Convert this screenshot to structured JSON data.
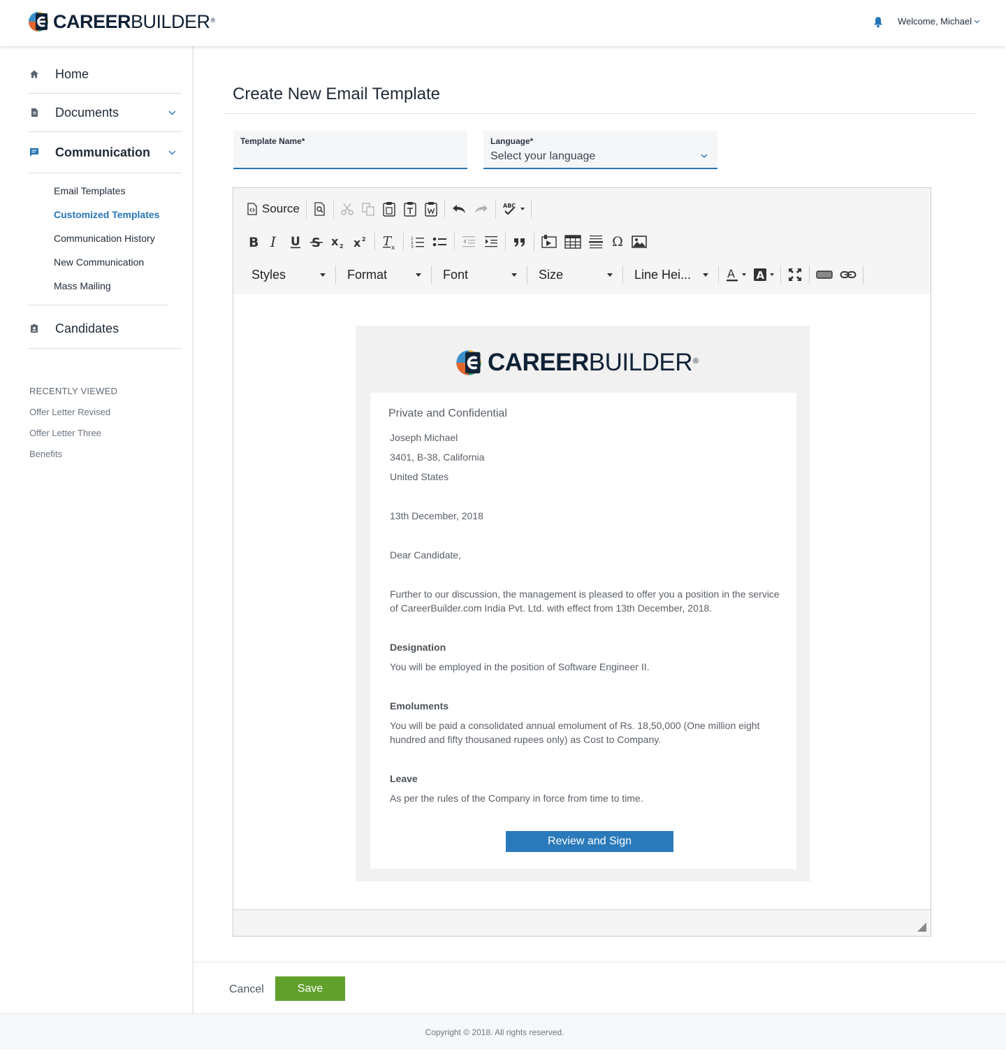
{
  "header": {
    "brand_bold": "CAREER",
    "brand_light": "BUILDER",
    "brand_mark": "®",
    "welcome": "Welcome, Michael",
    "icons": [
      "bell-icon",
      "chevron-down-icon"
    ]
  },
  "sidebar": {
    "items": [
      {
        "label": "Home",
        "icon": "home-icon"
      },
      {
        "label": "Documents",
        "icon": "document-icon"
      },
      {
        "label": "Communication",
        "icon": "chat-icon"
      },
      {
        "label": "Candidates",
        "icon": "contact-card-icon"
      }
    ],
    "sub_items": [
      {
        "label": "Email Templates"
      },
      {
        "label": "Customized Templates"
      },
      {
        "label": "Communication History"
      },
      {
        "label": "New Communication"
      },
      {
        "label": "Mass Mailing"
      }
    ],
    "recent_title": "RECENTLY VIEWED",
    "recent": [
      "Offer Letter Revised",
      "Offer Letter Three",
      "Benefits"
    ]
  },
  "main": {
    "title": "Create New Email Template",
    "template_name_label": "Template Name*",
    "template_name_value": "",
    "language_label": "Language*",
    "language_value": "Select your language"
  },
  "editor": {
    "source_label": "Source",
    "combos": [
      "Styles",
      "Format",
      "Font",
      "Size",
      "Line Hei..."
    ],
    "accent_color": "#2675b7"
  },
  "email": {
    "brand_bold": "CAREER",
    "brand_light": "BUILDER",
    "brand_mark": "®",
    "heading": "Private and Confidential",
    "name": "Joseph Michael",
    "address": "3401, B-38, California",
    "country": "United States",
    "date": "13th December, 2018",
    "salutation": "Dear Candidate,",
    "intro": "Further to our discussion, the management is pleased to offer you a position in the service of CareerBuilder.com India Pvt. Ltd. with effect from 13th December, 2018.",
    "designation_head": "Designation",
    "designation_text": "You will be employed in the position of Software Engineer II.",
    "emoluments_head": "Emoluments",
    "emoluments_text": "You will be paid a consolidated annual emolument of Rs. 18,50,000 (One million eight hundred and fifty thousaned rupees only) as Cost to Company.",
    "leave_head": "Leave",
    "leave_text": "As per the rules of the Company in force from time to time.",
    "cta_label": "Review and Sign",
    "cta_color": "#2a7abb"
  },
  "actions": {
    "cancel_label": "Cancel",
    "save_label": "Save",
    "save_color": "#62a02c"
  },
  "footer": {
    "copyright": "Copyright © 2018. All rights reserved."
  }
}
